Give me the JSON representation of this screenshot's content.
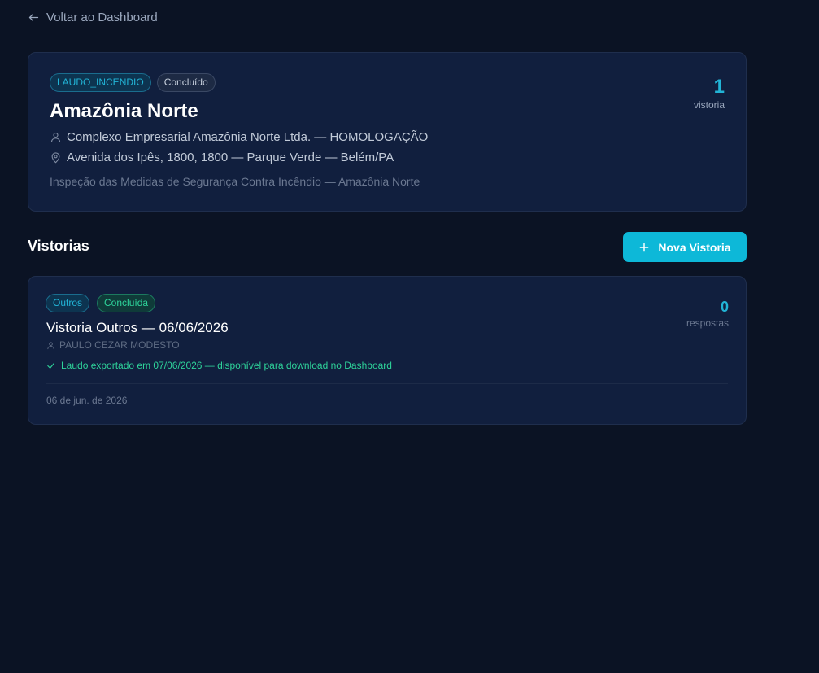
{
  "nav": {
    "back_label": "Voltar ao Dashboard"
  },
  "project": {
    "type_badge": "LAUDO_INCENDIO",
    "status_badge": "Concluído",
    "title": "Amazônia Norte",
    "client": "Complexo Empresarial Amazônia Norte Ltda. — HOMOLOGAÇÃO",
    "address": "Avenida dos Ipês, 1800, 1800 — Parque Verde — Belém/PA",
    "description": "Inspeção das Medidas de Segurança Contra Incêndio — Amazônia Norte",
    "count": "1",
    "count_label": "vistoria"
  },
  "section": {
    "title": "Vistorias",
    "new_button_label": "Nova Vistoria"
  },
  "vistorias": [
    {
      "category_badge": "Outros",
      "status_badge": "Concluída",
      "title": "Vistoria Outros — 06/06/2026",
      "inspector": "PAULO CEZAR MODESTO",
      "export_note": "Laudo exportado em 07/06/2026 — disponível para download no Dashboard",
      "date": "06 de jun. de 2026",
      "responses_count": "0",
      "responses_label": "respostas"
    }
  ],
  "icons": {
    "back": "arrow-left-icon",
    "client": "user-icon",
    "address": "map-pin-icon",
    "new": "plus-icon",
    "inspector": "user-icon",
    "export": "check-icon"
  },
  "colors": {
    "background": "#0b1324",
    "card": "#111f3e",
    "accent": "#0db8d8",
    "success": "#2ed39a"
  }
}
